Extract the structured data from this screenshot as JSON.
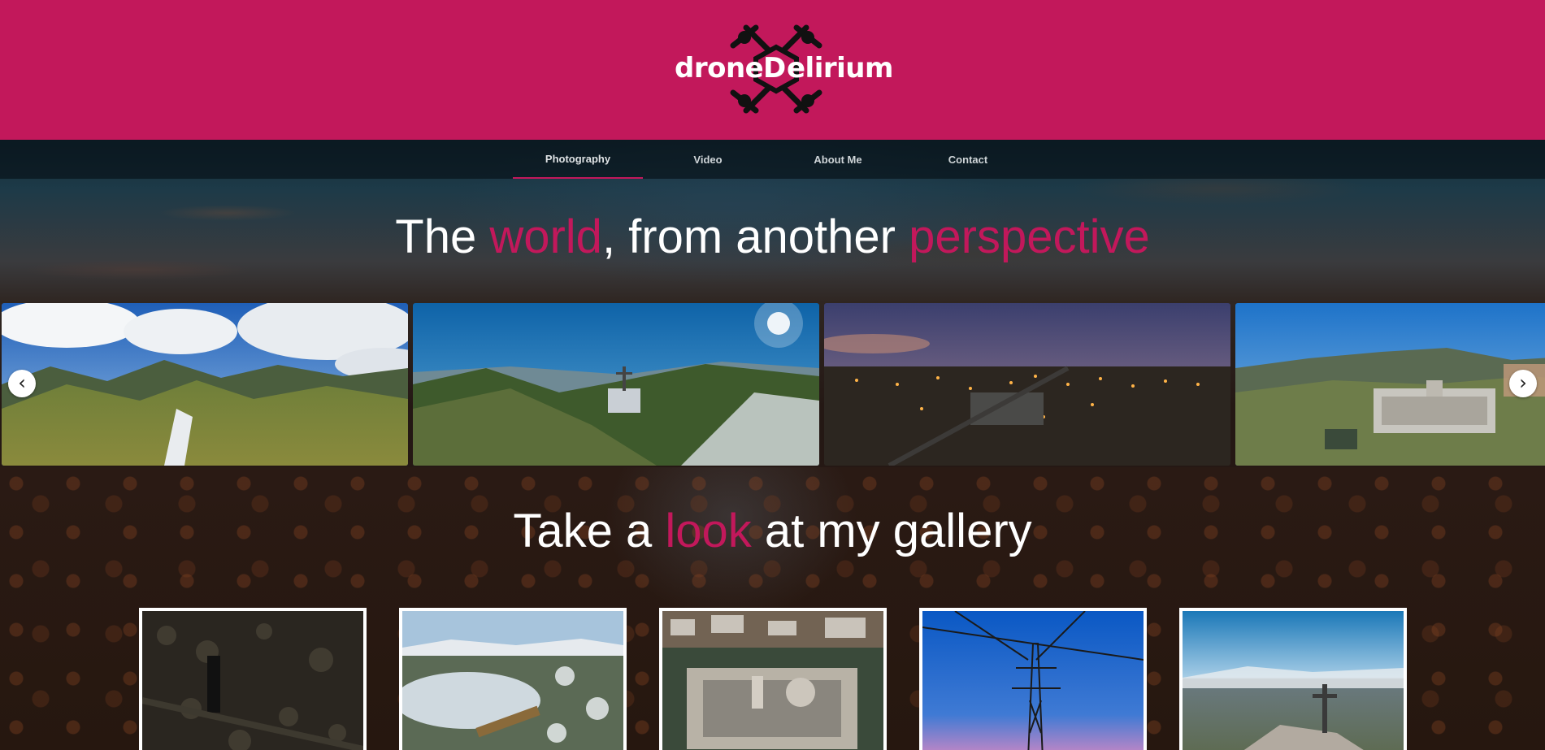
{
  "brand": {
    "logo_word_1": "drone",
    "logo_letter": "D",
    "logo_word_2": "elirium",
    "color": "#c2185b"
  },
  "nav": {
    "items": [
      {
        "label": "Photography",
        "active": true
      },
      {
        "label": "Video",
        "active": false
      },
      {
        "label": "About Me",
        "active": false
      },
      {
        "label": "Contact",
        "active": false
      }
    ]
  },
  "hero": {
    "headline_part1": "The ",
    "headline_accent1": "world",
    "headline_part2": ", from another ",
    "headline_accent2": "perspective"
  },
  "carousel": {
    "prev_icon": "‹",
    "next_icon": "›",
    "slides": [
      {
        "name": "mountain-valley-panorama"
      },
      {
        "name": "forest-monument-cross-panorama"
      },
      {
        "name": "city-night-panorama"
      },
      {
        "name": "monastery-town-panorama"
      }
    ]
  },
  "gallery": {
    "headline_part1": "Take a ",
    "headline_accent": "look",
    "headline_part2": " at my gallery",
    "thumbs": [
      {
        "name": "dark-forest-shadow"
      },
      {
        "name": "snowy-reservoir-dam"
      },
      {
        "name": "monastery-aerial"
      },
      {
        "name": "power-tower-sky"
      },
      {
        "name": "monument-cross-landscape"
      }
    ]
  }
}
